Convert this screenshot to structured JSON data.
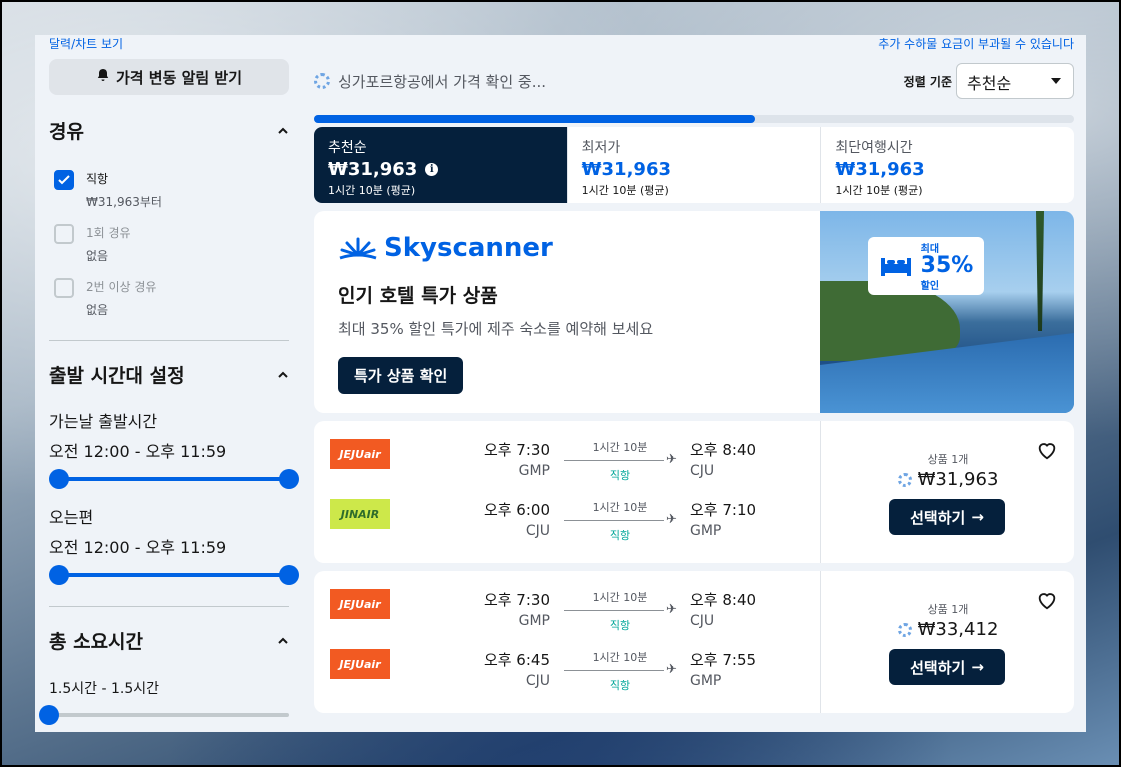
{
  "top_links": {
    "calendar": "달력/차트 보기",
    "fees_notice": "추가 수하물 요금이 부과될 수 있습니다"
  },
  "sidebar": {
    "alert_button": "가격 변동 알림 받기",
    "stops": {
      "title": "경유",
      "options": [
        {
          "label": "직항",
          "sub": "₩31,963부터",
          "checked": true
        },
        {
          "label": "1회 경유",
          "sub": "없음",
          "checked": false
        },
        {
          "label": "2번 이상 경유",
          "sub": "없음",
          "checked": false
        }
      ]
    },
    "times": {
      "title": "출발 시간대 설정",
      "outbound_label": "가는날 출발시간",
      "outbound_range": "오전 12:00 - 오후 11:59",
      "return_label": "오는편",
      "return_range": "오전 12:00 - 오후 11:59"
    },
    "duration": {
      "title": "총 소요시간",
      "range": "1.5시간 - 1.5시간"
    }
  },
  "main": {
    "loading_text": "싱가포르항공에서 가격 확인 중...",
    "sort_label": "정렬 기준",
    "sort_value": "추천순",
    "progress": 0.58,
    "tabs": [
      {
        "name": "추천순",
        "price": "₩31,963",
        "sub": "1시간 10분 (평균)",
        "active": true
      },
      {
        "name": "최저가",
        "price": "₩31,963",
        "sub": "1시간 10분 (평균)",
        "active": false
      },
      {
        "name": "최단여행시간",
        "price": "₩31,963",
        "sub": "1시간 10분 (평균)",
        "active": false
      }
    ],
    "promo": {
      "brand": "Skyscanner",
      "title": "인기 호텔 특가 상품",
      "description": "최대 35% 할인 특가에 제주 숙소를 예약해 보세요",
      "button": "특가 상품 확인",
      "badge_top": "최대",
      "badge_big": "35%",
      "badge_bottom": "할인"
    },
    "flights": [
      {
        "legs": [
          {
            "airline": "JEJUair",
            "dep_time": "오후 7:30",
            "dep_code": "GMP",
            "duration": "1시간 10분",
            "stops": "직항",
            "arr_time": "오후 8:40",
            "arr_code": "CJU"
          },
          {
            "airline": "JINAIR",
            "dep_time": "오후 6:00",
            "dep_code": "CJU",
            "duration": "1시간 10분",
            "stops": "직항",
            "arr_time": "오후 7:10",
            "arr_code": "GMP"
          }
        ],
        "deal_count": "상품 1개",
        "price": "₩31,963",
        "select_label": "선택하기"
      },
      {
        "legs": [
          {
            "airline": "JEJUair",
            "dep_time": "오후 7:30",
            "dep_code": "GMP",
            "duration": "1시간 10분",
            "stops": "직항",
            "arr_time": "오후 8:40",
            "arr_code": "CJU"
          },
          {
            "airline": "JEJUair",
            "dep_time": "오후 6:45",
            "dep_code": "CJU",
            "duration": "1시간 10분",
            "stops": "직항",
            "arr_time": "오후 7:55",
            "arr_code": "GMP"
          }
        ],
        "deal_count": "상품 1개",
        "price": "₩33,412",
        "select_label": "선택하기"
      }
    ]
  },
  "colors": {
    "accent": "#0062e3",
    "dark": "#05203c",
    "direct": "#00a698"
  }
}
